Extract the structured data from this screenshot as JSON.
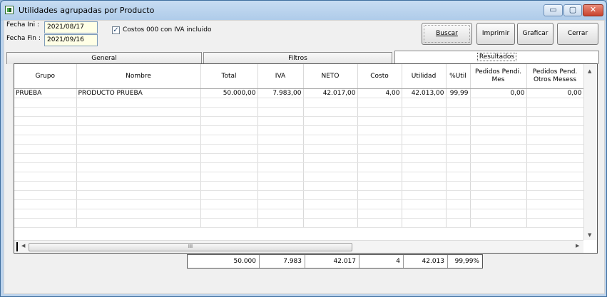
{
  "window": {
    "title": "Utilidades agrupadas por Producto",
    "minimize": "▭",
    "maximize": "▢",
    "close": "✕"
  },
  "form": {
    "fecha_ini_label": "Fecha Ini :",
    "fecha_ini_value": "2021/08/17",
    "fecha_fin_label": "Fecha Fin :",
    "fecha_fin_value": "2021/09/16",
    "costos_checkbox_label": "Costos 000 con IVA incluido",
    "costos_checkbox_checked": true
  },
  "buttons": {
    "buscar": "Buscar",
    "imprimir": "Imprimir",
    "graficar": "Graficar",
    "cerrar": "Cerrar"
  },
  "tabs": [
    {
      "label": "General"
    },
    {
      "label": "Filtros"
    },
    {
      "label": "Resultados"
    }
  ],
  "grid": {
    "columns": [
      "Grupo",
      "Nombre",
      "Total",
      "IVA",
      "NETO",
      "Costo",
      "Utilidad",
      "%Util",
      "Pedidos Pendi. Mes",
      "Pedidos Pend. Otros Mesess"
    ],
    "rows": [
      {
        "grupo": "PRUEBA",
        "nombre": "PRODUCTO PRUEBA",
        "total": "50.000,00",
        "iva": "7.983,00",
        "neto": "42.017,00",
        "costo": "4,00",
        "utilidad": "42.013,00",
        "util_pct": "99,99",
        "pend_mes": "0,00",
        "pend_otros": "0,00"
      }
    ],
    "scroll_thumb_label": "III"
  },
  "totals": {
    "total": "50.000",
    "iva": "7.983",
    "neto": "42.017",
    "costo": "4",
    "utilidad": "42.013",
    "util_pct": "99,99%"
  },
  "icons": {
    "scroll_up": "▲",
    "scroll_down": "▼",
    "scroll_left": "◀",
    "scroll_right": "▶",
    "check": "✓"
  }
}
